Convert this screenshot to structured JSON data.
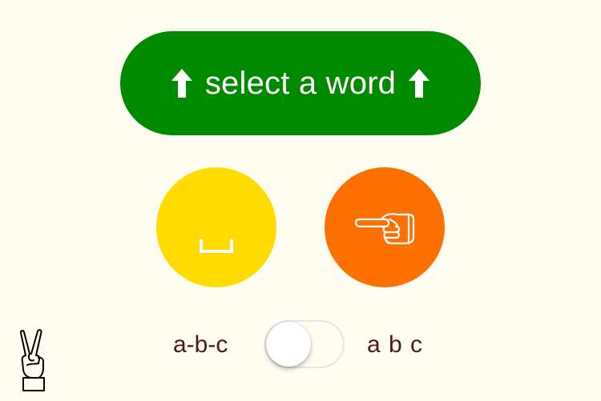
{
  "select_button": {
    "label": "select a word",
    "left_icon": "up-arrow-icon",
    "right_icon": "up-arrow-icon",
    "color": "#008a00"
  },
  "space_button": {
    "icon": "space-bracket-icon",
    "color": "#ffdb00"
  },
  "point_button": {
    "icon": "pointing-hand-icon",
    "color": "#ff7000"
  },
  "peace_sign": {
    "icon": "peace-hand-icon"
  },
  "separator_toggle": {
    "left_label": "a-b-c",
    "right_label": "a b c",
    "state": "off"
  },
  "background_color": "#fffdf0"
}
